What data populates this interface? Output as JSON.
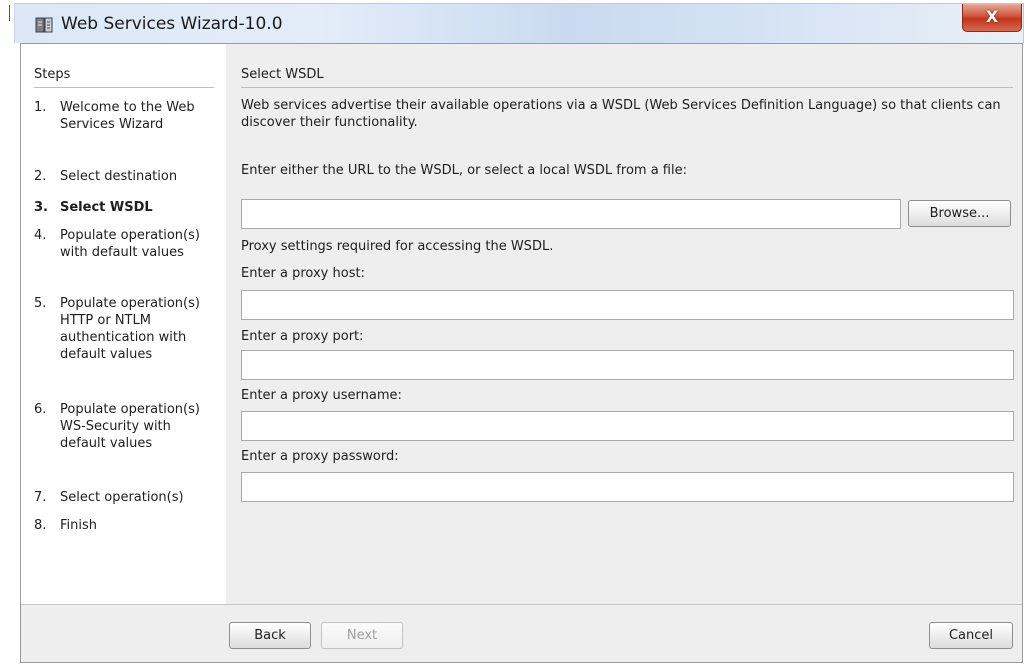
{
  "window": {
    "title": "Web Services Wizard-10.0",
    "close_glyph": "X"
  },
  "steps": {
    "header": "Steps",
    "items": [
      {
        "num": "1.",
        "label": "Welcome to the Web Services Wizard"
      },
      {
        "num": "2.",
        "label": "Select destination"
      },
      {
        "num": "3.",
        "label": "Select WSDL",
        "current": true
      },
      {
        "num": "4.",
        "label": "Populate operation(s) with default values"
      },
      {
        "num": "5.",
        "label": "Populate operation(s) HTTP or NTLM authentication with default values"
      },
      {
        "num": "6.",
        "label": "Populate operation(s) WS-Security with default values"
      },
      {
        "num": "7.",
        "label": "Select operation(s)"
      },
      {
        "num": "8.",
        "label": "Finish"
      }
    ]
  },
  "content": {
    "title": "Select WSDL",
    "description": "Web services advertise their available operations via a WSDL (Web Services Definition Language) so that clients can discover their functionality.",
    "url_prompt": "Enter either the URL to the WSDL, or select a local WSDL from a file:",
    "url_value": "",
    "browse_label": "Browse...",
    "proxy_note": "Proxy settings required for accessing the WSDL.",
    "proxy_host_label": "Enter a proxy host:",
    "proxy_host_value": "",
    "proxy_port_label": "Enter a proxy port:",
    "proxy_port_value": "",
    "proxy_username_label": "Enter a proxy username:",
    "proxy_username_value": "",
    "proxy_password_label": "Enter a proxy password:",
    "proxy_password_value": ""
  },
  "footer": {
    "back_label": "Back",
    "next_label": "Next",
    "cancel_label": "Cancel"
  },
  "icons": {
    "app": "wizard-app-icon",
    "close": "close-icon"
  }
}
